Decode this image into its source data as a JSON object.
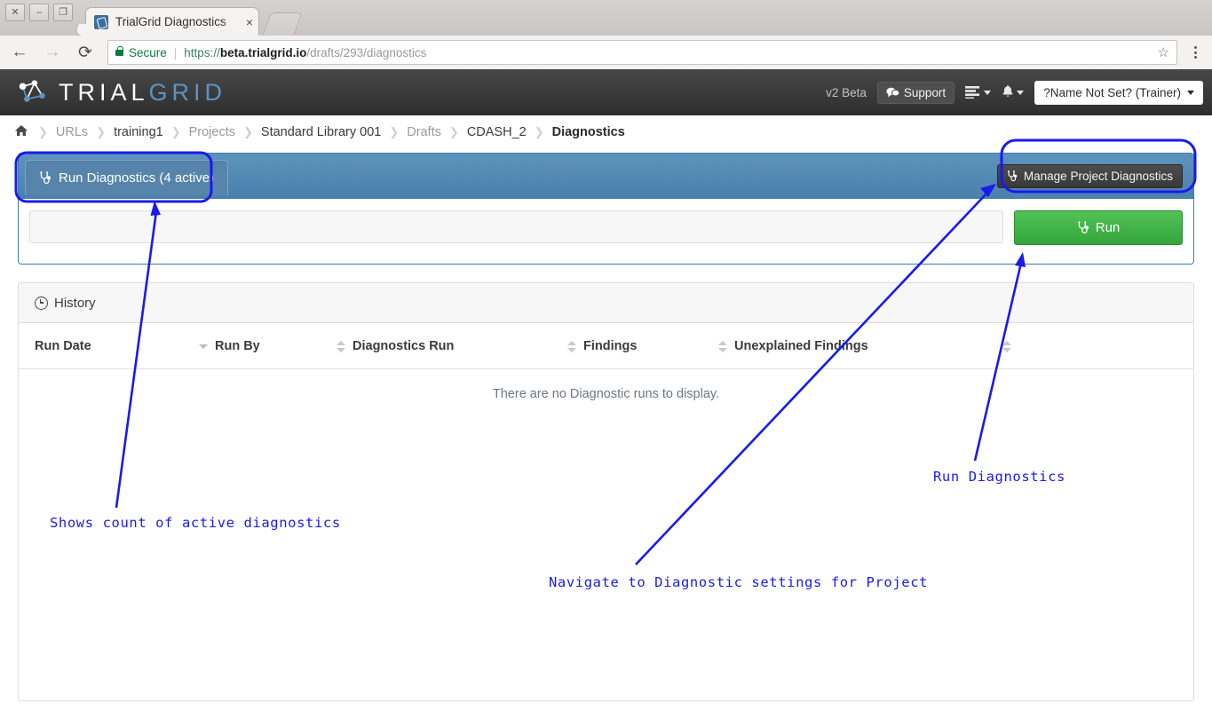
{
  "browser": {
    "window_controls": {
      "close": "✕",
      "minimize": "–",
      "maximize": "❐"
    },
    "tab": {
      "title": "TrialGrid Diagnostics",
      "close_label": "×",
      "favicon": "trialgrid-favicon"
    },
    "new_tab_label": "",
    "nav": {
      "back": "←",
      "forward": "→",
      "reload": "⟳"
    },
    "omnibox": {
      "security_label": "Secure",
      "separator": "|",
      "url_scheme": "https://",
      "url_host": "beta.trialgrid.io",
      "url_path": "/drafts/293/diagnostics",
      "star": "☆"
    }
  },
  "header": {
    "logo_primary": "TRIAL",
    "logo_secondary": "GRID",
    "version": "v2 Beta",
    "support_label": "Support",
    "apps_menu_label": "",
    "notifications_label": "",
    "user_label": "?Name Not Set? (Trainer)"
  },
  "breadcrumb": {
    "home_icon": "⌂",
    "separator": "❯",
    "items": [
      {
        "label": "URLs",
        "style": "muted"
      },
      {
        "label": "training1",
        "style": "strong"
      },
      {
        "label": "Projects",
        "style": "muted"
      },
      {
        "label": "Standard Library 001",
        "style": "strong"
      },
      {
        "label": "Drafts",
        "style": "muted"
      },
      {
        "label": "CDASH_2",
        "style": "strong"
      },
      {
        "label": "Diagnostics",
        "style": "current"
      }
    ]
  },
  "diagnostics_panel": {
    "tab_label": "Run Diagnostics (4 active)",
    "active_count": 4,
    "manage_button_label": "Manage Project Diagnostics",
    "select_value": "",
    "select_placeholder": "",
    "run_button_label": "Run",
    "accent_color": "#4a81ad",
    "run_button_color": "#3eb145"
  },
  "history_panel": {
    "title": "History",
    "columns": [
      {
        "label": "Run Date",
        "sort": "desc"
      },
      {
        "label": "Run By",
        "sort": "none"
      },
      {
        "label": "Diagnostics Run",
        "sort": "none"
      },
      {
        "label": "Findings",
        "sort": "none"
      },
      {
        "label": "Unexplained Findings",
        "sort": "none"
      },
      {
        "label": "",
        "sort": "none"
      }
    ],
    "rows": [],
    "empty_message": "There are no Diagnostic runs to display."
  },
  "annotations": {
    "color": "#1a1aee",
    "notes": [
      {
        "id": "note-active-count",
        "text": "Shows count of active diagnostics"
      },
      {
        "id": "note-run-diagnostics",
        "text": "Run Diagnostics"
      },
      {
        "id": "note-navigate-settings",
        "text": "Navigate to Diagnostic settings for Project"
      }
    ]
  }
}
